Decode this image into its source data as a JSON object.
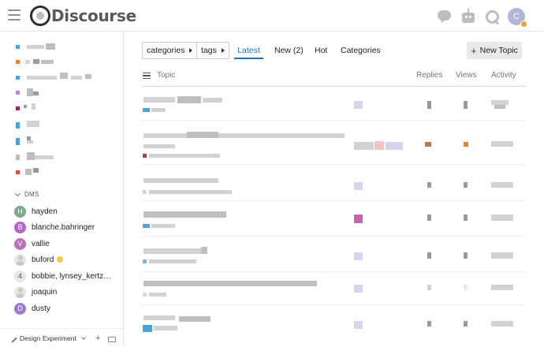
{
  "header": {
    "logo_text": "Discourse",
    "user_initial": "C"
  },
  "sidebar": {
    "dms_label": "DMS",
    "dms": [
      {
        "name": "hayden",
        "initial": "H",
        "color": "#7fa88a"
      },
      {
        "name": "blanche.bahringer",
        "initial": "B",
        "color": "#b166c8"
      },
      {
        "name": "vallie",
        "initial": "V",
        "color": "#b872b6"
      },
      {
        "name": "buford",
        "initial": "",
        "color": ""
      },
      {
        "name": "bobbie, lynsey_kertz…",
        "initial": "4",
        "color": ""
      },
      {
        "name": "joaquin",
        "initial": "",
        "color": ""
      },
      {
        "name": "dusty",
        "initial": "D",
        "color": "#9a7bd1"
      }
    ],
    "footer_label": "Design Experiment"
  },
  "nav": {
    "categories_label": "categories",
    "tags_label": "tags",
    "tabs": [
      "Latest",
      "New (2)",
      "Hot",
      "Categories"
    ],
    "new_topic_label": "New Topic"
  },
  "table": {
    "col_topic": "Topic",
    "col_replies": "Replies",
    "col_views": "Views",
    "col_activity": "Activity"
  },
  "colors": {
    "accent": "#1f74b7",
    "category_colors": [
      "#4aa3d8",
      "#e8822f",
      "#4aa3d8",
      "#b18ad8",
      "#9e1f5e",
      "#4aa3d8",
      "#4aa3d8",
      "#e04a3a"
    ]
  }
}
